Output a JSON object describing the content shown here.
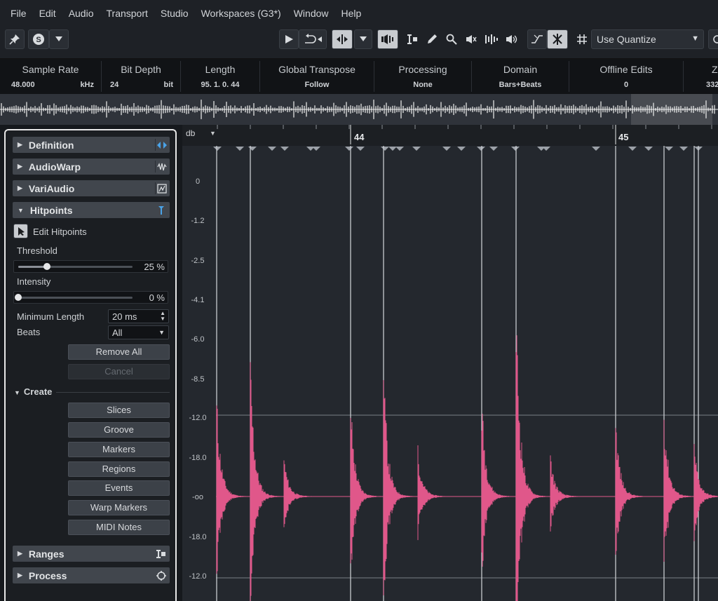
{
  "menu": [
    "File",
    "Edit",
    "Audio",
    "Transport",
    "Studio",
    "Workspaces (G3*)",
    "Window",
    "Help"
  ],
  "toolbar": {
    "icons": [
      "pin-icon",
      "solo-icon",
      "dropdown-icon",
      "play-icon",
      "loop-icon",
      "snap-icon",
      "speaker-icon",
      "range-icon",
      "pencil-icon",
      "zoom-icon",
      "mute-icon",
      "warp-icon",
      "volume-icon",
      "curve-icon",
      "hitpoint-icon",
      "grid-icon"
    ],
    "quantize_label": "Use Quantize"
  },
  "infoline": [
    {
      "label": "Sample Rate",
      "value": "48.000",
      "unit": "kHz"
    },
    {
      "label": "Bit Depth",
      "value": "24",
      "unit": "bit"
    },
    {
      "label": "Length",
      "value": "95. 1. 0. 44"
    },
    {
      "label": "Global Transpose",
      "value": "Follow"
    },
    {
      "label": "Processing",
      "value": "None"
    },
    {
      "label": "Domain",
      "value": "Bars+Beats"
    },
    {
      "label": "Offline Edits",
      "value": "0"
    },
    {
      "label": "Zo",
      "value": "332"
    }
  ],
  "inspector": {
    "sections": {
      "definition": "Definition",
      "audiowarp": "AudioWarp",
      "variaudio": "VariAudio",
      "hitpoints": "Hitpoints",
      "ranges": "Ranges",
      "process": "Process"
    },
    "edit_hitpoints": "Edit Hitpoints",
    "threshold_label": "Threshold",
    "threshold_value": "25 %",
    "threshold_level": 0.25,
    "intensity_label": "Intensity",
    "intensity_value": "0 %",
    "intensity_level": 0,
    "min_length_label": "Minimum Length",
    "min_length_value": "20 ms",
    "beats_label": "Beats",
    "beats_value": "All",
    "remove_all": "Remove All",
    "cancel": "Cancel",
    "create_label": "Create",
    "create_buttons": [
      "Slices",
      "Groove",
      "Markers",
      "Regions",
      "Events",
      "Warp Markers",
      "MIDI Notes"
    ]
  },
  "editor": {
    "db_selector": "db",
    "bars": [
      "44",
      "45"
    ],
    "db_labels": [
      "0",
      "-1.2",
      "-2.5",
      "-4.1",
      "-6.0",
      "-8.5",
      "-12.0",
      "-18.0",
      "-oo",
      "-18.0",
      "-12.0"
    ],
    "waveform_color": "#e0578a",
    "accent_color": "#4aa3e8"
  }
}
